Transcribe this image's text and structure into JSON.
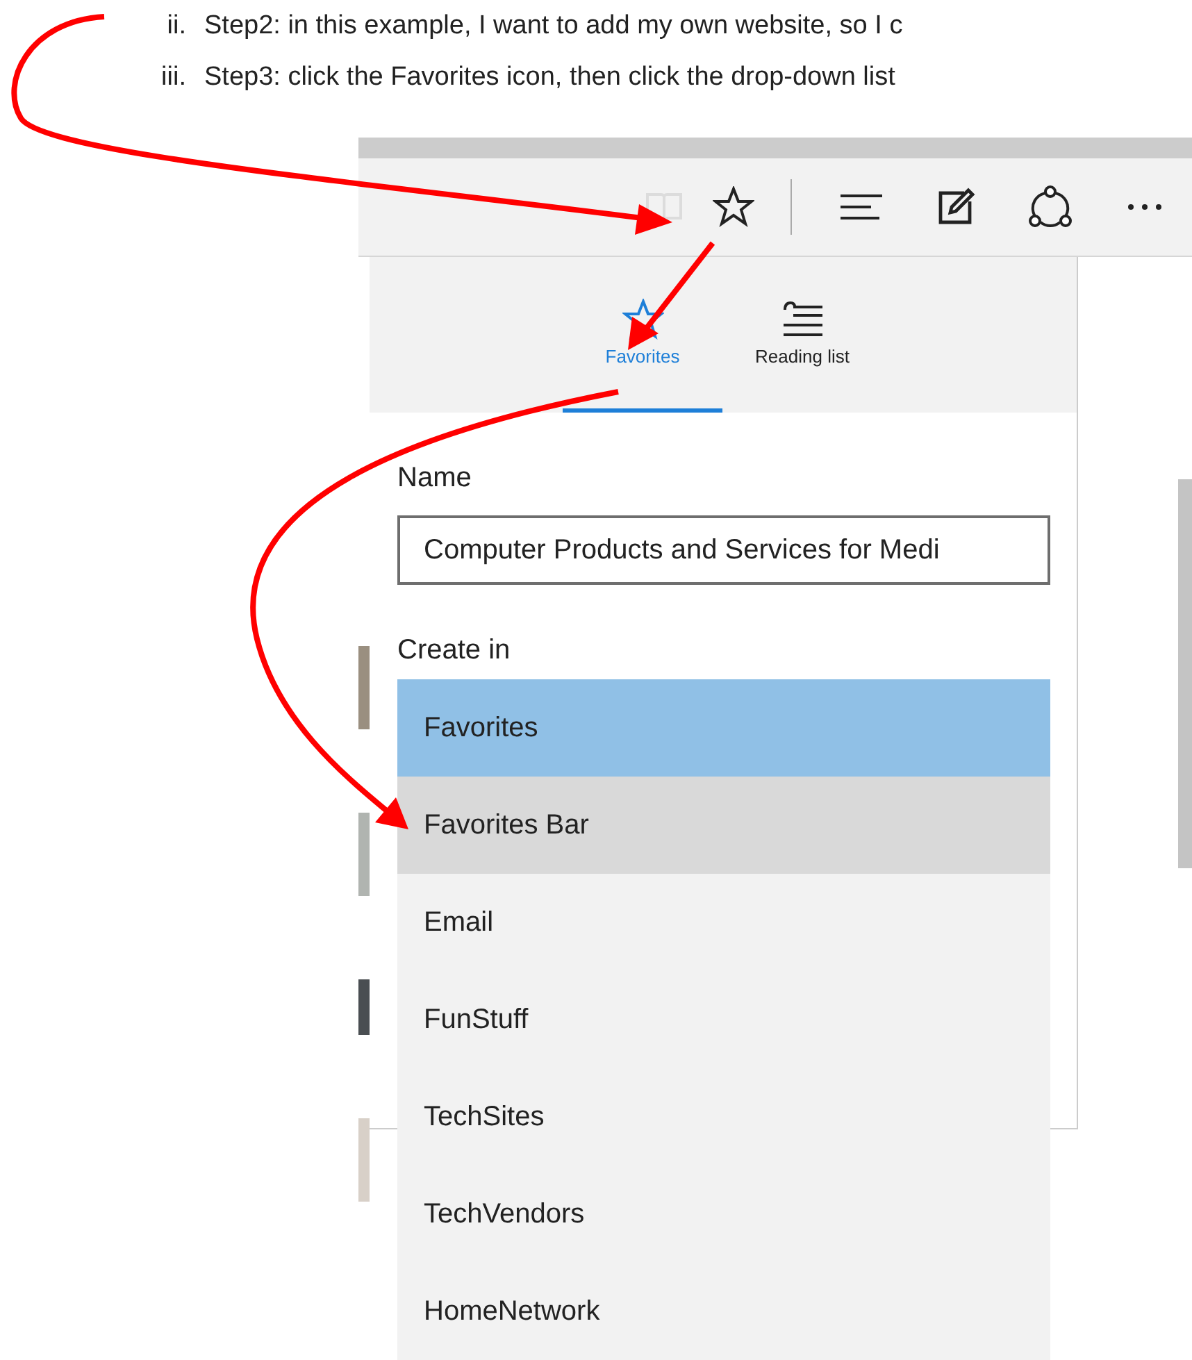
{
  "instructions": [
    {
      "marker": "ii.",
      "text": "Step2: in this example, I want to add my own website, so I c"
    },
    {
      "marker": "iii.",
      "text": "Step3: click the Favorites icon, then click the drop-down list"
    }
  ],
  "toolbar": [
    {
      "kind": "reading-view",
      "disabled": true
    },
    {
      "kind": "favorites",
      "disabled": false
    },
    {
      "kind": "hub",
      "disabled": false
    },
    {
      "kind": "note",
      "disabled": false
    },
    {
      "kind": "share",
      "disabled": false
    },
    {
      "kind": "more",
      "disabled": false
    }
  ],
  "panel": {
    "tabs": [
      {
        "kind": "star",
        "label": "Favorites",
        "selected": true
      },
      {
        "kind": "list",
        "label": "Reading list",
        "selected": false
      }
    ],
    "name_label": "Name",
    "name_value": "Computer Products and Services for Medi",
    "create_in_label": "Create in",
    "folders": [
      {
        "label": "Favorites",
        "selected": true,
        "highlighted": false
      },
      {
        "label": "Favorites Bar",
        "selected": false,
        "highlighted": true
      },
      {
        "label": "Email",
        "selected": false,
        "highlighted": false
      },
      {
        "label": "FunStuff",
        "selected": false,
        "highlighted": false
      },
      {
        "label": "TechSites",
        "selected": false,
        "highlighted": false
      },
      {
        "label": "TechVendors",
        "selected": false,
        "highlighted": false
      },
      {
        "label": "HomeNetwork",
        "selected": false,
        "highlighted": false
      }
    ]
  }
}
